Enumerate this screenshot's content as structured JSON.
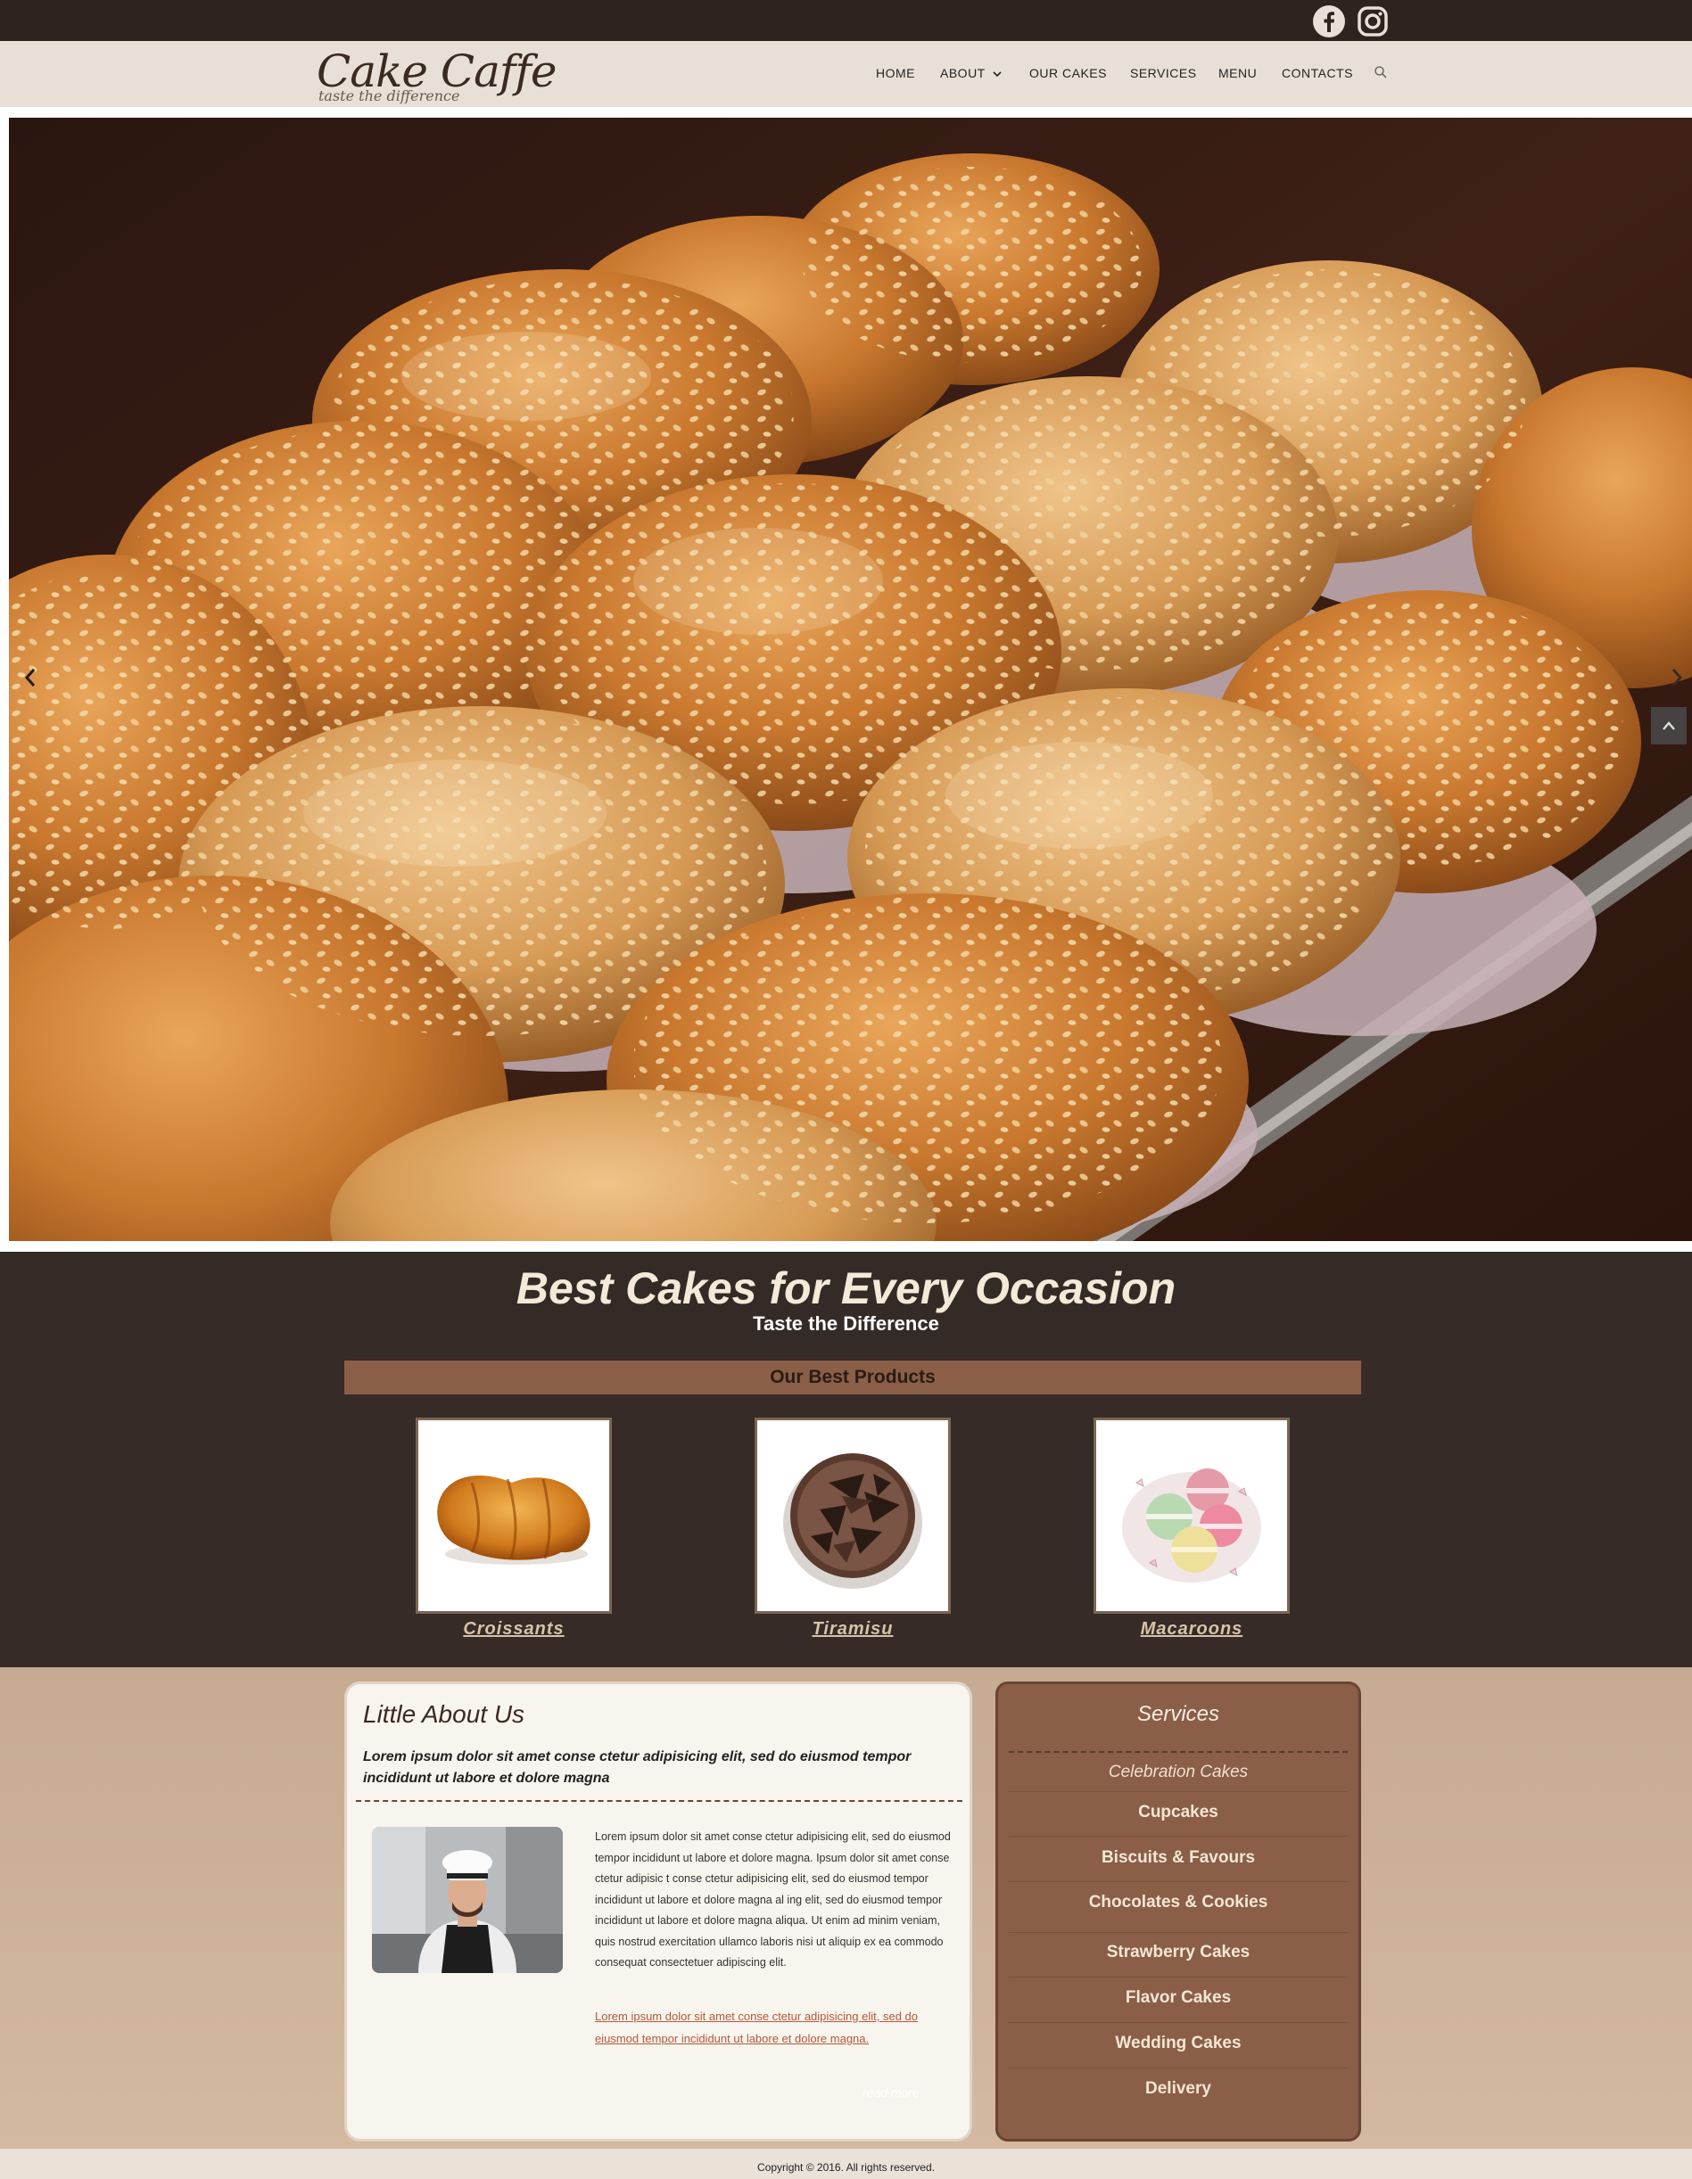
{
  "header": {
    "logo_text": "Cake Caffe",
    "tagline": "taste the difference",
    "nav": [
      {
        "label": "HOME"
      },
      {
        "label": "ABOUT"
      },
      {
        "label": "OUR CAKES"
      },
      {
        "label": "SERVICES"
      },
      {
        "label": "MENU"
      },
      {
        "label": "CONTACTS"
      }
    ],
    "social_icons": [
      "facebook-icon",
      "instagram-icon"
    ]
  },
  "hero": {
    "image": "muffins-with-sesame-seeds",
    "prev_icon": "chevron-left-icon",
    "next_icon": "chevron-right-icon",
    "scroll_top_icon": "chevron-up-icon"
  },
  "banner": {
    "title": "Best Cakes for Every Occasion",
    "subtitle": "Taste the Difference"
  },
  "products": {
    "heading": "Our Best Products",
    "items": [
      {
        "name": "Croissants",
        "image": "croissant"
      },
      {
        "name": "Tiramisu",
        "image": "tiramisu"
      },
      {
        "name": "Macaroons",
        "image": "macaroons"
      }
    ]
  },
  "about": {
    "title": "Little About Us",
    "lead": "Lorem ipsum dolor sit amet conse ctetur adipisicing elit, sed do eiusmod tempor incididunt ut labore et dolore magna",
    "body": "Lorem ipsum dolor sit amet conse ctetur adipisicing elit, sed do eiusmod tempor incididunt ut labore et dolore magna. Ipsum dolor sit amet conse ctetur adipisic t conse ctetur adipisicing elit, sed do eiusmod tempor incididunt ut labore et dolore magna al ing elit, sed do eiusmod tempor incididunt ut labore et dolore magna aliqua. Ut enim ad minim veniam, quis nostrud exercitation ullamco laboris nisi ut aliquip ex ea commodo consequat consectetuer adipiscing elit.",
    "link": "Lorem ipsum dolor sit amet conse ctetur adipisicing elit, sed do eiusmod tempor incididunt ut labore et dolore magna.",
    "read_more": "read more"
  },
  "services": {
    "title": "Services",
    "items": [
      "Celebration Cakes",
      "Cupcakes",
      "Biscuits & Favours",
      "Chocolates & Cookies",
      "Strawberry Cakes",
      "Flavor Cakes",
      "Wedding Cakes",
      "Delivery"
    ]
  },
  "footer": {
    "copyright": "Copyright © 2016. All rights reserved."
  },
  "colors": {
    "topbar": "#2d241f",
    "header": "#e8e0d6",
    "banner": "#342b27",
    "accent": "#8a5e47",
    "lower_bg": "#cdb29a"
  }
}
